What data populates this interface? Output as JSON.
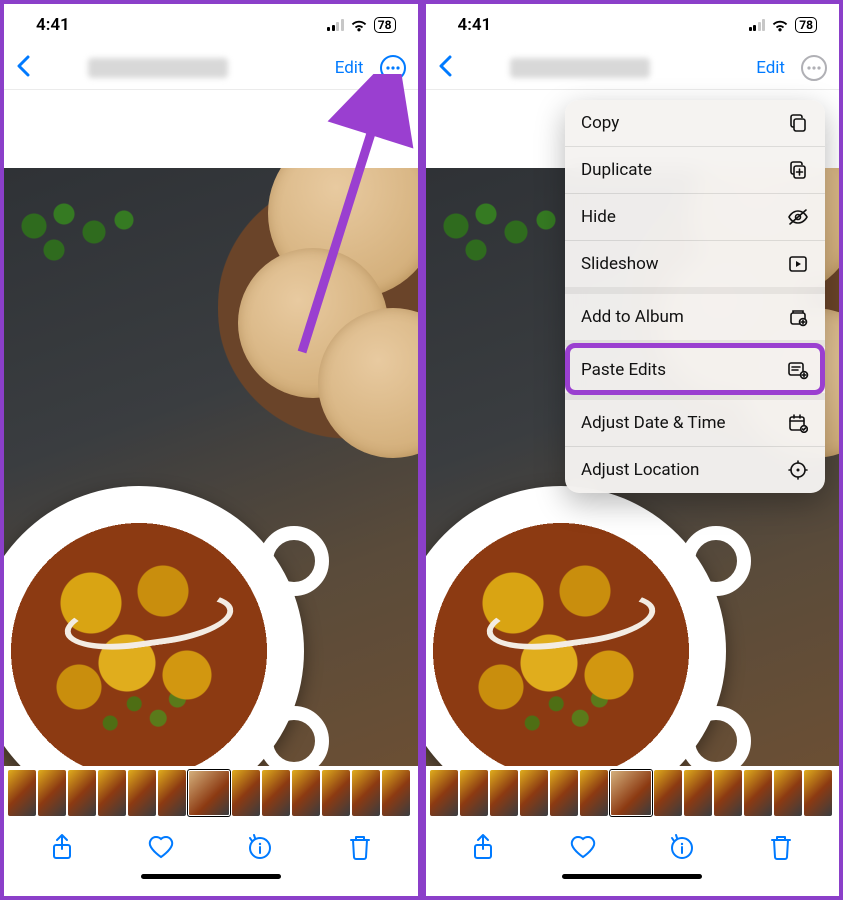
{
  "status": {
    "time": "4:41",
    "battery": "78"
  },
  "nav": {
    "edit_label": "Edit"
  },
  "menu": {
    "copy": "Copy",
    "duplicate": "Duplicate",
    "hide": "Hide",
    "slideshow": "Slideshow",
    "add_to_album": "Add to Album",
    "paste_edits": "Paste Edits",
    "adjust_date": "Adjust Date & Time",
    "adjust_location": "Adjust Location"
  },
  "colors": {
    "accent": "#007aff",
    "annotation": "#9a3fd0"
  }
}
